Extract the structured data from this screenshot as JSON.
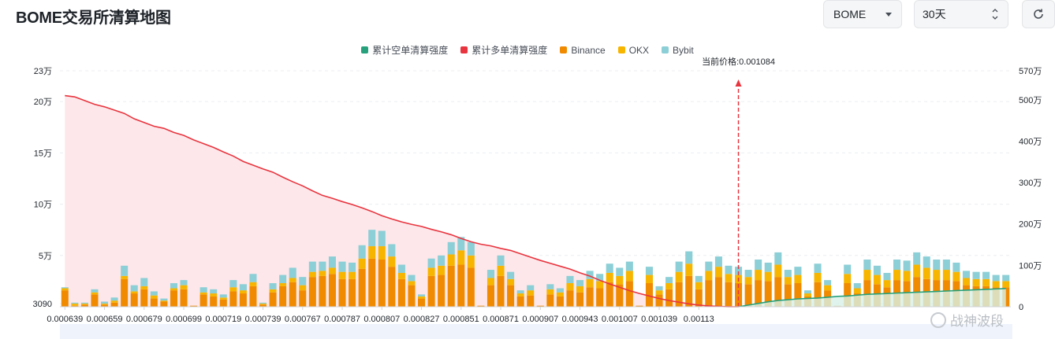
{
  "header": {
    "title": "BOME交易所清算地图",
    "symbol_select": "BOME",
    "range_select": "30天",
    "refresh_icon": "refresh-icon"
  },
  "legend": [
    {
      "label": "累计空单清算强度",
      "color": "#26a17b"
    },
    {
      "label": "累计多单清算强度",
      "color": "#e8343e"
    },
    {
      "label": "Binance",
      "color": "#f08a00"
    },
    {
      "label": "OKX",
      "color": "#f7b500"
    },
    {
      "label": "Bybit",
      "color": "#8ccfd6"
    }
  ],
  "watermark": "战神波段",
  "chart_data": {
    "type": "bar",
    "current_price_label": "当前价格:0.001084",
    "current_price_index": 68,
    "left_axis": {
      "ticks": [
        "3090",
        "5万",
        "10万",
        "15万",
        "20万",
        "23万"
      ],
      "range": [
        0,
        230000
      ]
    },
    "right_axis": {
      "ticks": [
        "0",
        "100万",
        "200万",
        "300万",
        "400万",
        "500万",
        "570万"
      ],
      "range": [
        0,
        5700000
      ]
    },
    "x_tick_labels": [
      "0.000639",
      "0.000659",
      "0.000679",
      "0.000699",
      "0.000719",
      "0.000739",
      "0.000767",
      "0.000787",
      "0.000807",
      "0.000827",
      "0.000851",
      "0.000871",
      "0.000907",
      "0.000943",
      "0.001007",
      "0.001039",
      "0.00113"
    ],
    "x_tick_indices": [
      0,
      4,
      8,
      12,
      16,
      20,
      24,
      28,
      32,
      36,
      40,
      44,
      48,
      52,
      56,
      60,
      64
    ],
    "series": [
      {
        "name": "Binance",
        "color": "#f08a00",
        "values": [
          16000,
          1000,
          2000,
          12000,
          2000,
          4000,
          27000,
          13000,
          17000,
          8000,
          5000,
          16000,
          17000,
          1000,
          12000,
          10000,
          7000,
          15000,
          13000,
          20000,
          2000,
          14000,
          20000,
          24000,
          16000,
          29000,
          30000,
          32000,
          27000,
          27000,
          37000,
          47000,
          46000,
          39000,
          27000,
          21000,
          8000,
          30000,
          31000,
          40000,
          41000,
          38000,
          1000,
          21000,
          30000,
          21000,
          10000,
          11000,
          1000,
          12000,
          10000,
          16000,
          14000,
          19000,
          18000,
          24000,
          22000,
          25000,
          1000,
          23000,
          12000,
          17000,
          24000,
          30000,
          17000,
          26000,
          29000,
          24000,
          23000,
          22000,
          26000,
          25000,
          29000,
          22000,
          23000,
          10000,
          24000,
          16000,
          1000,
          23000,
          13000,
          26000,
          22000,
          19000,
          26000,
          25000,
          29000,
          27000,
          26000,
          26000,
          25000,
          21000,
          20000,
          20000,
          19000,
          19000
        ]
      },
      {
        "name": "OKX",
        "color": "#f7b500",
        "values": [
          2000,
          2000,
          1000,
          2000,
          1000,
          2000,
          3000,
          2000,
          3000,
          3000,
          1000,
          2000,
          4000,
          0,
          2000,
          3000,
          2000,
          4000,
          3000,
          4000,
          1000,
          3000,
          3000,
          4000,
          5000,
          5000,
          5000,
          6000,
          7000,
          7000,
          10000,
          12000,
          13000,
          10000,
          6000,
          4000,
          2000,
          8000,
          9000,
          11000,
          14000,
          12000,
          0,
          7000,
          10000,
          6000,
          3000,
          5000,
          0,
          5000,
          4000,
          7000,
          6000,
          8000,
          7000,
          9000,
          8000,
          10000,
          0,
          8000,
          4000,
          6000,
          10000,
          12000,
          7000,
          9000,
          10000,
          8000,
          8000,
          7000,
          10000,
          9000,
          12000,
          7000,
          8000,
          3000,
          9000,
          5000,
          0,
          9000,
          5000,
          10000,
          9000,
          7000,
          10000,
          10000,
          12000,
          11000,
          10000,
          10000,
          9000,
          7000,
          7000,
          7000,
          6000,
          6000
        ]
      },
      {
        "name": "Bybit",
        "color": "#8ccfd6",
        "values": [
          1000,
          1000,
          1000,
          3000,
          2000,
          3000,
          10000,
          6000,
          8000,
          4000,
          2000,
          5000,
          5000,
          0,
          5000,
          4000,
          3000,
          7000,
          6000,
          8000,
          1000,
          6000,
          8000,
          10000,
          8000,
          10000,
          9000,
          11000,
          10000,
          9000,
          13000,
          16000,
          15000,
          12000,
          8000,
          6000,
          2000,
          9000,
          10000,
          12000,
          13000,
          13000,
          0,
          8000,
          10000,
          7000,
          3000,
          5000,
          0,
          5000,
          4000,
          7000,
          6000,
          8000,
          7000,
          9000,
          8000,
          9000,
          0,
          8000,
          4000,
          6000,
          10000,
          12000,
          6000,
          9000,
          10000,
          8000,
          8000,
          7000,
          10000,
          9000,
          12000,
          7000,
          8000,
          3000,
          9000,
          5000,
          0,
          9000,
          5000,
          10000,
          9000,
          7000,
          10000,
          10000,
          12000,
          11000,
          10000,
          10000,
          9000,
          7000,
          7000,
          7000,
          6000,
          6000
        ]
      }
    ],
    "long_cumulative": [
      5100000,
      5070000,
      4980000,
      4890000,
      4830000,
      4750000,
      4670000,
      4540000,
      4450000,
      4360000,
      4310000,
      4210000,
      4140000,
      4030000,
      3940000,
      3850000,
      3740000,
      3640000,
      3510000,
      3420000,
      3330000,
      3250000,
      3130000,
      3020000,
      2920000,
      2800000,
      2690000,
      2620000,
      2540000,
      2470000,
      2390000,
      2300000,
      2200000,
      2120000,
      2050000,
      1990000,
      1940000,
      1870000,
      1810000,
      1740000,
      1650000,
      1570000,
      1510000,
      1470000,
      1410000,
      1360000,
      1280000,
      1200000,
      1120000,
      1050000,
      980000,
      910000,
      820000,
      740000,
      640000,
      550000,
      470000,
      390000,
      320000,
      260000,
      200000,
      150000,
      110000,
      70000,
      40000,
      20000,
      8000,
      2000,
      0
    ],
    "short_cumulative": [
      0,
      40000,
      80000,
      120000,
      150000,
      170000,
      190000,
      200000,
      210000,
      230000,
      250000,
      260000,
      280000,
      300000,
      310000,
      320000,
      330000,
      340000,
      350000,
      360000,
      370000,
      380000,
      390000,
      400000,
      410000,
      420000,
      430000,
      440000
    ]
  }
}
